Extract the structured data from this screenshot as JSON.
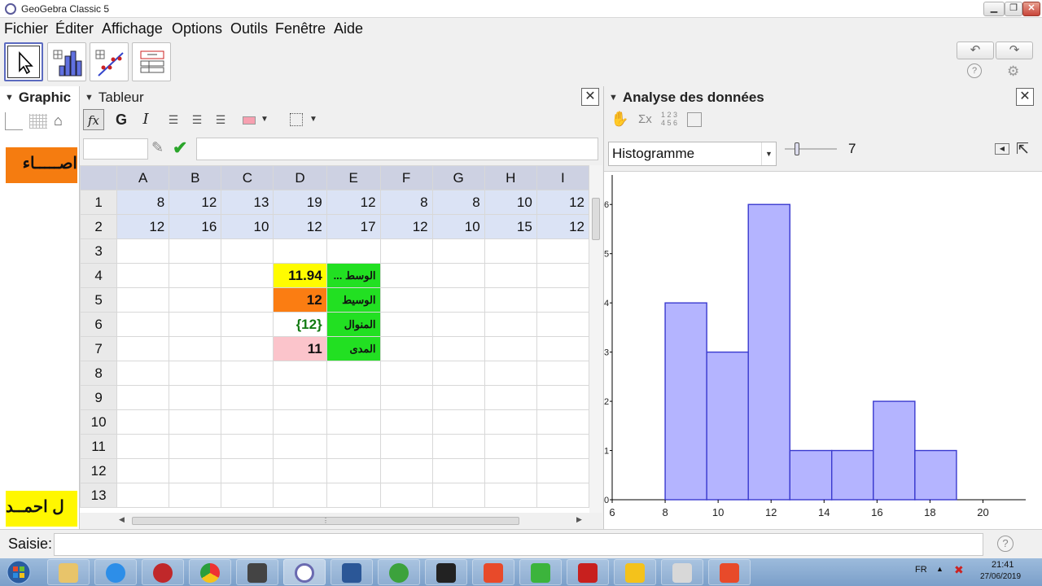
{
  "window": {
    "title": "GeoGebra Classic 5"
  },
  "menu": [
    "Fichier",
    "Éditer",
    "Affichage",
    "Options",
    "Outils",
    "Fenêtre",
    "Aide"
  ],
  "panels": {
    "graphics": {
      "title": "Graphic",
      "label_orange": "اصـــــاء",
      "label_yellow": "ل احمــد"
    },
    "spreadsheet": {
      "title": "Tableur"
    },
    "data": {
      "title": "Analyse des données"
    }
  },
  "format": {
    "fx": "fx",
    "bold": "G",
    "italic": "I"
  },
  "sheet": {
    "columns": [
      "A",
      "B",
      "C",
      "D",
      "E",
      "F",
      "G",
      "H",
      "I"
    ],
    "rows": [
      {
        "n": "1",
        "cells": [
          "8",
          "12",
          "13",
          "19",
          "12",
          "8",
          "8",
          "10",
          "12"
        ]
      },
      {
        "n": "2",
        "cells": [
          "12",
          "16",
          "10",
          "12",
          "17",
          "12",
          "10",
          "15",
          "12"
        ]
      },
      {
        "n": "3",
        "cells": [
          "",
          "",
          "",
          "",
          "",
          "",
          "",
          "",
          ""
        ]
      },
      {
        "n": "4",
        "cells": [
          "",
          "",
          "",
          "11.94",
          "الوسط ...",
          "",
          "",
          "",
          ""
        ]
      },
      {
        "n": "5",
        "cells": [
          "",
          "",
          "",
          "12",
          "الوسيط",
          "",
          "",
          "",
          ""
        ]
      },
      {
        "n": "6",
        "cells": [
          "",
          "",
          "",
          "{12}",
          "المنوال",
          "",
          "",
          "",
          ""
        ]
      },
      {
        "n": "7",
        "cells": [
          "",
          "",
          "",
          "11",
          "المدى",
          "",
          "",
          "",
          ""
        ]
      },
      {
        "n": "8",
        "cells": [
          "",
          "",
          "",
          "",
          "",
          "",
          "",
          "",
          ""
        ]
      },
      {
        "n": "9",
        "cells": [
          "",
          "",
          "",
          "",
          "",
          "",
          "",
          "",
          ""
        ]
      },
      {
        "n": "10",
        "cells": [
          "",
          "",
          "",
          "",
          "",
          "",
          "",
          "",
          ""
        ]
      },
      {
        "n": "11",
        "cells": [
          "",
          "",
          "",
          "",
          "",
          "",
          "",
          "",
          ""
        ]
      },
      {
        "n": "12",
        "cells": [
          "",
          "",
          "",
          "",
          "",
          "",
          "",
          "",
          ""
        ]
      },
      {
        "n": "13",
        "cells": [
          "",
          "",
          "",
          "",
          "",
          "",
          "",
          "",
          ""
        ]
      }
    ]
  },
  "analysis": {
    "plot_type": "Histogramme",
    "slider_value": "7",
    "toolbar_text": {
      "sigma": "Σx",
      "nums": "1 2 3\n4 5 6"
    }
  },
  "chart_data": {
    "type": "bar",
    "title": "",
    "xlabel": "",
    "ylabel": "",
    "xlim": [
      6,
      21
    ],
    "ylim": [
      0,
      6.5
    ],
    "xticks": [
      6,
      8,
      10,
      12,
      14,
      16,
      18,
      20
    ],
    "yticks": [
      0,
      1,
      2,
      3,
      4,
      5,
      6
    ],
    "bins": [
      {
        "from": 8,
        "to": 9.57,
        "count": 4
      },
      {
        "from": 9.57,
        "to": 11.14,
        "count": 3
      },
      {
        "from": 11.14,
        "to": 12.71,
        "count": 6
      },
      {
        "from": 12.71,
        "to": 14.29,
        "count": 1
      },
      {
        "from": 14.29,
        "to": 15.86,
        "count": 1
      },
      {
        "from": 15.86,
        "to": 17.43,
        "count": 2
      },
      {
        "from": 17.43,
        "to": 19,
        "count": 1
      }
    ],
    "colors": {
      "fill": "#b4b4ff",
      "stroke": "#3a3acf"
    },
    "grid": false
  },
  "inputbar": {
    "label": "Saisie:"
  },
  "taskbar": {
    "lang": "FR",
    "time": "21:41",
    "date": "27/06/2019"
  }
}
